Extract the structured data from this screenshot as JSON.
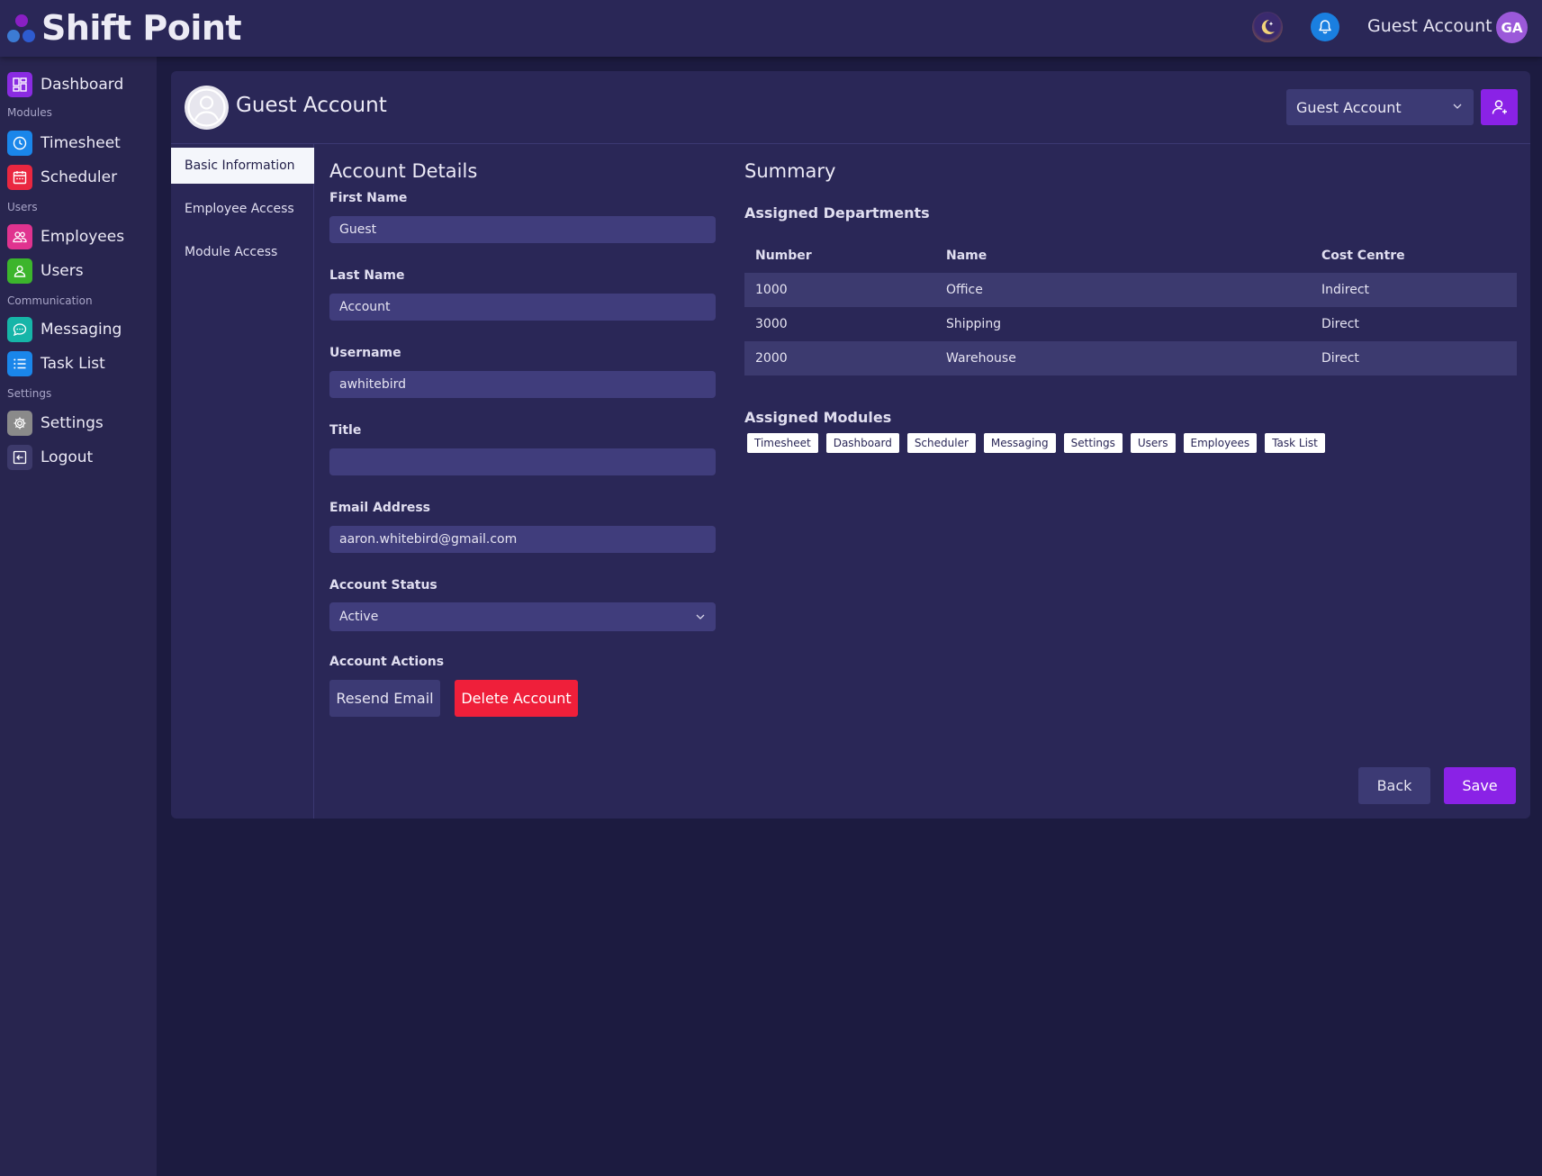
{
  "app": {
    "name": "Shift Point"
  },
  "topbar": {
    "user_name": "Guest Account",
    "avatar_initials": "GA"
  },
  "sidebar": {
    "items": [
      {
        "label": "Dashboard",
        "icon": "dashboard-icon",
        "color": "#8a2be2"
      },
      {
        "label": "Timesheet",
        "icon": "clock-icon",
        "color": "#1a86ea"
      },
      {
        "label": "Scheduler",
        "icon": "calendar-icon",
        "color": "#ea2740"
      },
      {
        "label": "Employees",
        "icon": "people-icon",
        "color": "#e0338f"
      },
      {
        "label": "Users",
        "icon": "user-icon",
        "color": "#3cb52c"
      },
      {
        "label": "Messaging",
        "icon": "chat-icon",
        "color": "#16b5a8"
      },
      {
        "label": "Task List",
        "icon": "list-icon",
        "color": "#1a86ea"
      },
      {
        "label": "Settings",
        "icon": "gear-icon",
        "color": "#8a8a8a"
      },
      {
        "label": "Logout",
        "icon": "logout-icon",
        "color": "#3d3a6b"
      }
    ],
    "sections": [
      "Modules",
      "Users",
      "Communication",
      "Settings"
    ]
  },
  "header": {
    "title": "Guest Account",
    "account_select": "Guest Account"
  },
  "tabs": [
    "Basic Information",
    "Employee Access",
    "Module Access"
  ],
  "account_details": {
    "title": "Account Details",
    "first_name_label": "First Name",
    "first_name": "Guest",
    "last_name_label": "Last Name",
    "last_name": "Account",
    "username_label": "Username",
    "username": "awhitebird",
    "title_label": "Title",
    "title_value": "",
    "email_label": "Email Address",
    "email": "aaron.whitebird@gmail.com",
    "status_label": "Account Status",
    "status": "Active",
    "actions_label": "Account Actions",
    "resend_label": "Resend Email",
    "delete_label": "Delete Account"
  },
  "summary": {
    "title": "Summary",
    "departments_title": "Assigned Departments",
    "columns": [
      "Number",
      "Name",
      "Cost Centre"
    ],
    "rows": [
      [
        "1000",
        "Office",
        "Indirect"
      ],
      [
        "3000",
        "Shipping",
        "Direct"
      ],
      [
        "2000",
        "Warehouse",
        "Direct"
      ]
    ],
    "modules_title": "Assigned Modules",
    "modules": [
      "Timesheet",
      "Dashboard",
      "Scheduler",
      "Messaging",
      "Settings",
      "Users",
      "Employees",
      "Task List"
    ]
  },
  "footer": {
    "back_label": "Back",
    "save_label": "Save"
  },
  "colors": {
    "background": "#1c1b40",
    "panel": "#2a2757",
    "accent": "#8a22e6",
    "danger": "#ef1f3a"
  }
}
